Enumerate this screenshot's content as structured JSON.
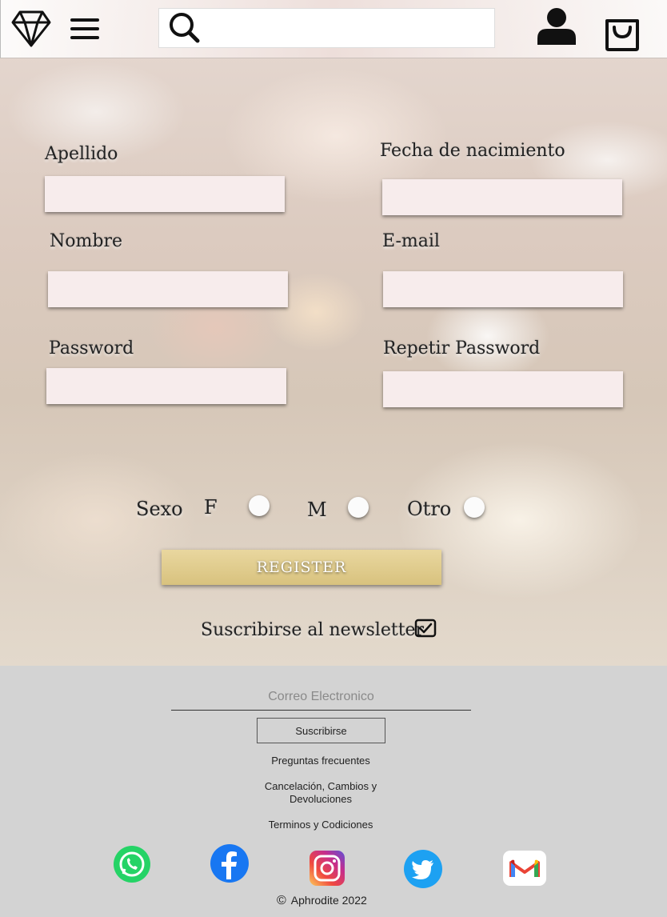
{
  "header": {
    "logo_icon": "diamond-icon",
    "menu_icon": "hamburger-menu-icon",
    "search_icon": "search-icon",
    "search_value": "",
    "user_icon": "user-icon",
    "cart_icon": "shopping-bag-icon"
  },
  "form": {
    "apellido_label": "Apellido",
    "fecha_label": "Fecha de nacimiento",
    "nombre_label": "Nombre",
    "email_label": "E-mail",
    "password_label": "Password",
    "repeat_password_label": "Repetir Password",
    "sexo_label": "Sexo",
    "sexo_options": [
      "F",
      "M",
      "Otro"
    ],
    "register_label": "REGISTER",
    "newsletter_label": "Suscribirse al newsletter",
    "newsletter_checked": true
  },
  "footer": {
    "email_placeholder": "Correo Electronico",
    "subscribe_label": "Suscribirse",
    "links": [
      "Preguntas frecuentes",
      "Cancelación, Cambios y Devoluciones",
      "Terminos y Codiciones"
    ],
    "social_icons": [
      "whatsapp-icon",
      "facebook-icon",
      "instagram-icon",
      "twitter-icon",
      "gmail-icon"
    ],
    "copyright_symbol": "©",
    "copyright_text": "Aphrodite 2022"
  },
  "colors": {
    "register_gold": "#d8c27e",
    "field_bg": "#f7ecec",
    "footer_bg": "#d3d3d3",
    "whatsapp": "#25d366",
    "facebook": "#1877f2",
    "twitter": "#1da1f2"
  }
}
